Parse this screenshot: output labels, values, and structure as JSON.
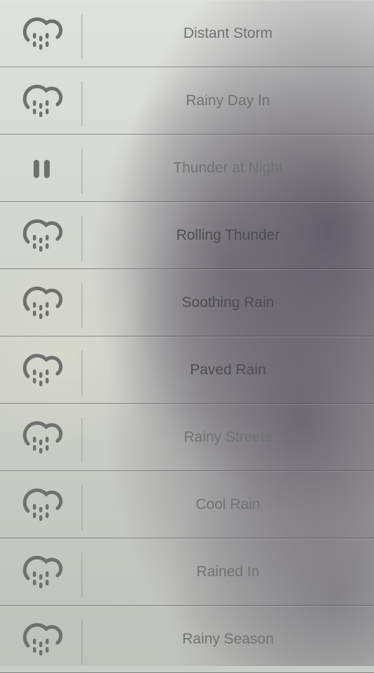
{
  "sounds": [
    {
      "title": "Distant Storm",
      "icon": "rain-cloud-icon",
      "state": "stopped"
    },
    {
      "title": "Rainy Day In",
      "icon": "rain-cloud-icon",
      "state": "stopped"
    },
    {
      "title": "Thunder at Night",
      "icon": "pause-icon",
      "state": "playing"
    },
    {
      "title": "Rolling Thunder",
      "icon": "rain-cloud-icon",
      "state": "stopped"
    },
    {
      "title": "Soothing Rain",
      "icon": "rain-cloud-icon",
      "state": "stopped"
    },
    {
      "title": "Paved Rain",
      "icon": "rain-cloud-icon",
      "state": "stopped"
    },
    {
      "title": "Rainy Streets",
      "icon": "rain-cloud-icon",
      "state": "stopped"
    },
    {
      "title": "Cool Rain",
      "icon": "rain-cloud-icon",
      "state": "stopped"
    },
    {
      "title": "Rained In",
      "icon": "rain-cloud-icon",
      "state": "stopped"
    },
    {
      "title": "Rainy Season",
      "icon": "rain-cloud-icon",
      "state": "stopped"
    }
  ],
  "colors": {
    "icon": "#6f716f",
    "text_light": "#707271",
    "text_dark": "#4d4d50"
  }
}
